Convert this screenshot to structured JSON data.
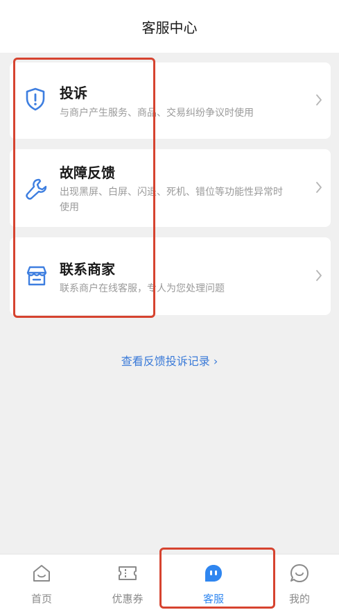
{
  "header": {
    "title": "客服中心"
  },
  "cards": [
    {
      "title": "投诉",
      "desc": "与商户产生服务、商品、交易纠纷争议时使用",
      "icon": "shield-exclamation-icon"
    },
    {
      "title": "故障反馈",
      "desc": "出现黑屏、白屏、闪退、死机、错位等功能性异常时使用",
      "icon": "wrench-icon"
    },
    {
      "title": "联系商家",
      "desc": "联系商户在线客服，专人为您处理问题",
      "icon": "store-icon"
    }
  ],
  "history_link": {
    "label": "查看反馈投诉记录 ›"
  },
  "tabbar": {
    "items": [
      {
        "label": "首页",
        "icon": "home-icon",
        "active": false
      },
      {
        "label": "优惠券",
        "icon": "coupon-icon",
        "active": false
      },
      {
        "label": "客服",
        "icon": "chat-bot-icon",
        "active": true
      },
      {
        "label": "我的",
        "icon": "smile-chat-icon",
        "active": false
      }
    ]
  },
  "colors": {
    "accent": "#2f86f0",
    "link": "#3a7ad8",
    "highlight": "#d6432f",
    "icon": "#3d7ee0"
  }
}
